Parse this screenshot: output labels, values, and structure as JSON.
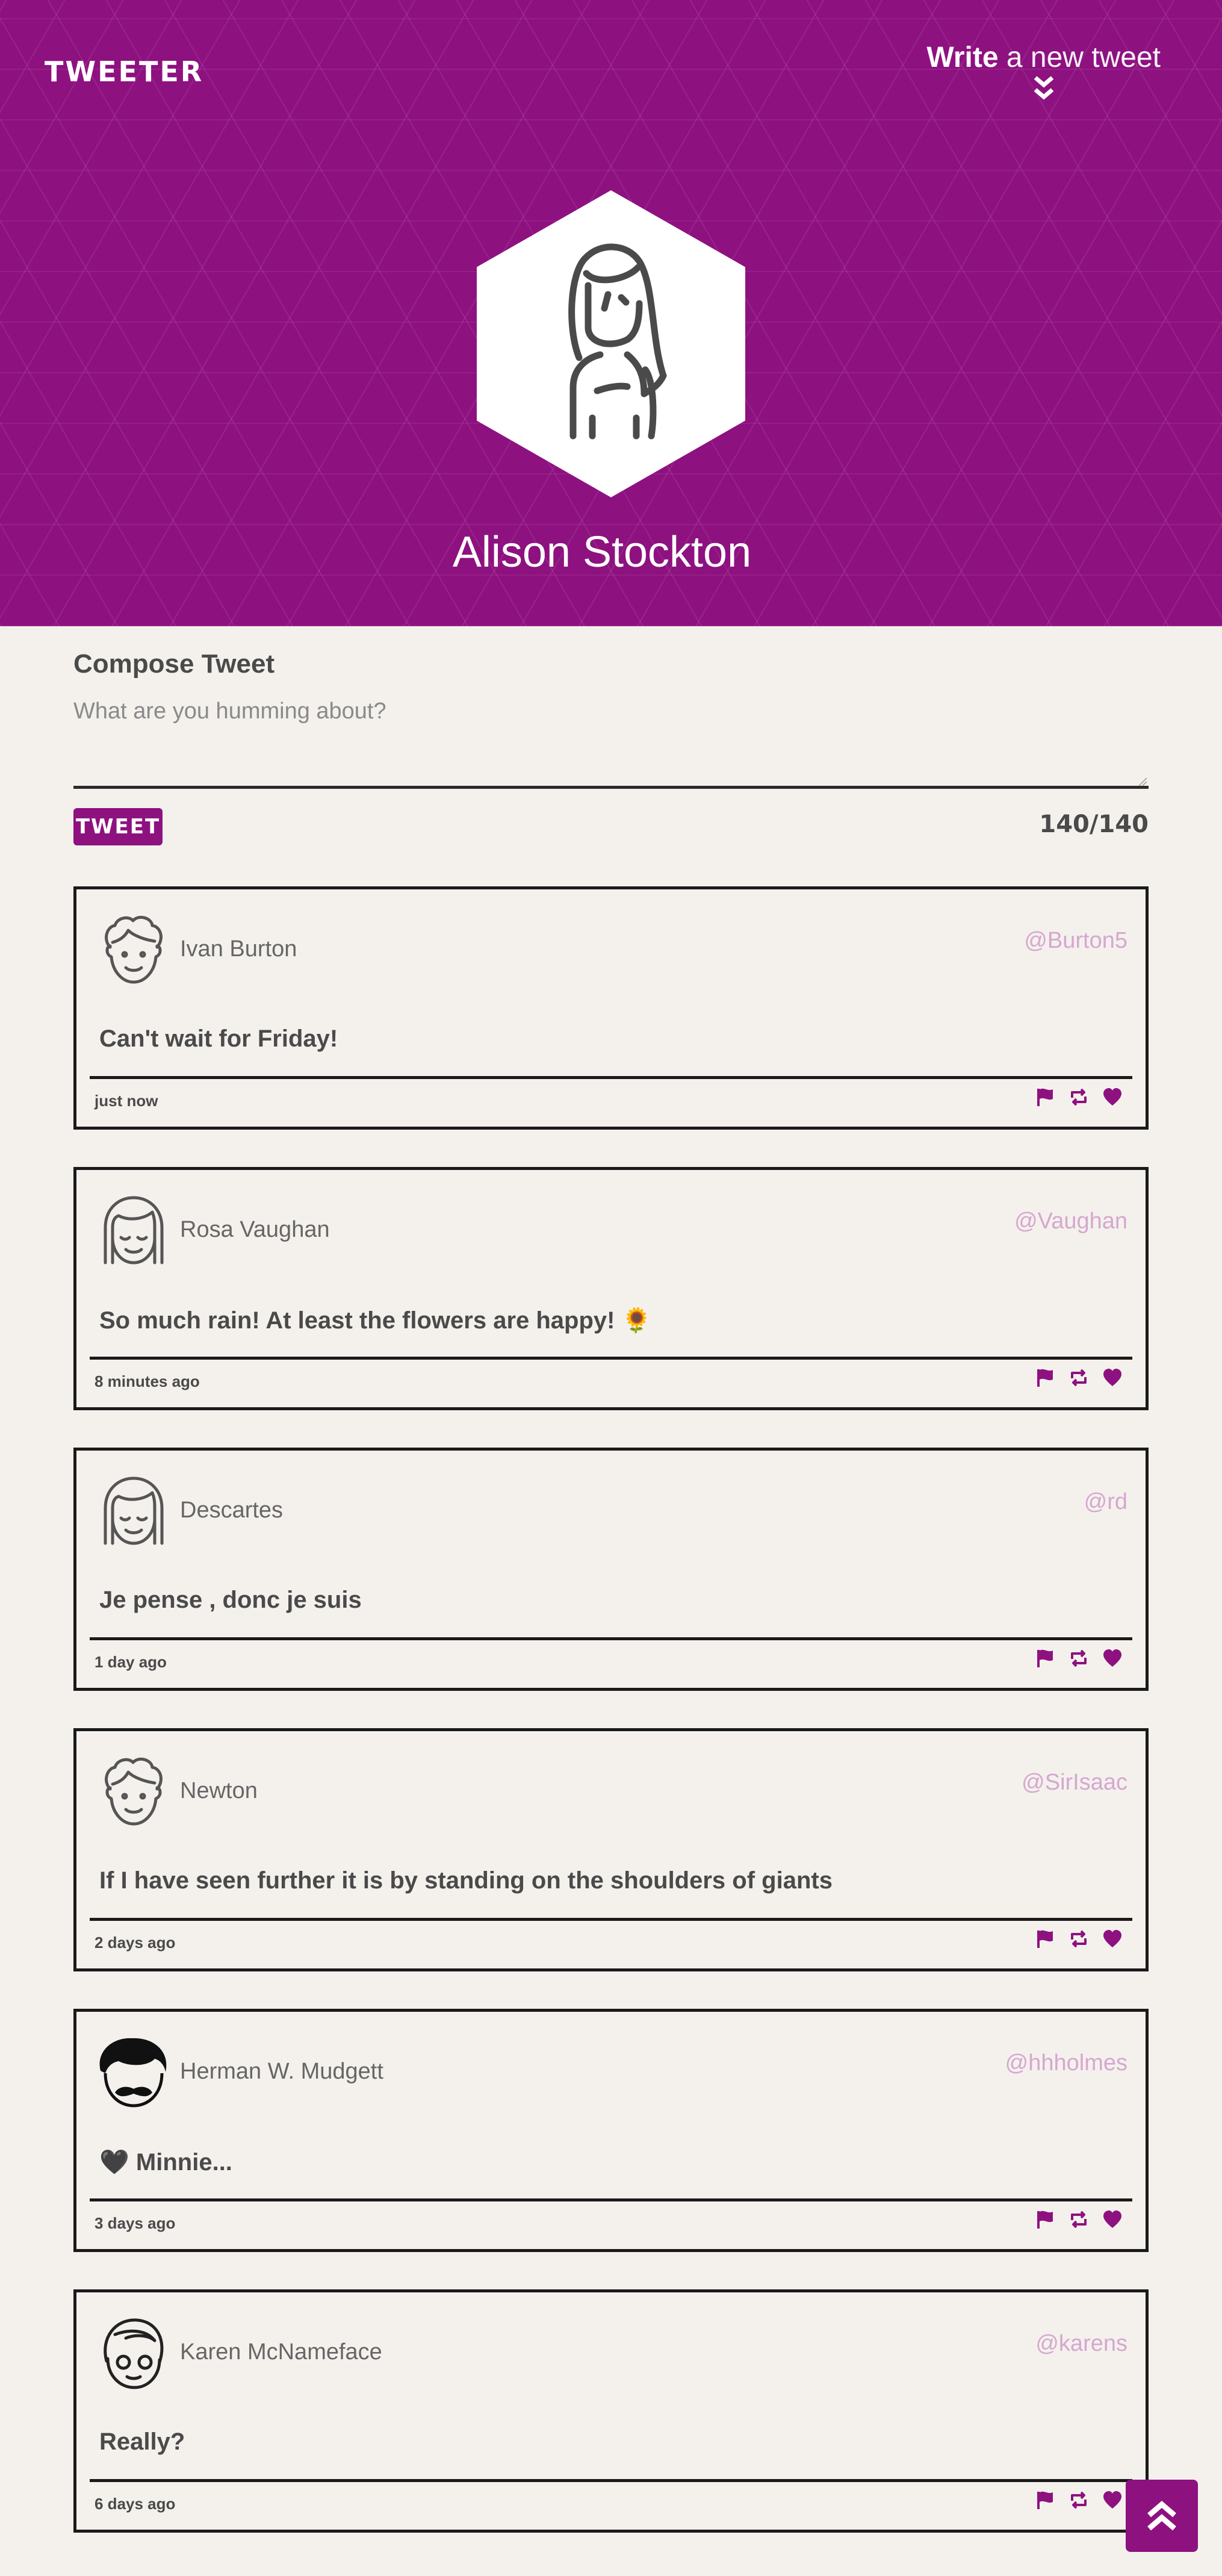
{
  "header": {
    "logo": "TWEETER",
    "write_bold": "Write",
    "write_rest": " a new tweet",
    "profile_name": "Alison Stockton"
  },
  "compose": {
    "title": "Compose Tweet",
    "placeholder": "What are you humming about?",
    "button_label": "TWEET",
    "counter": "140/140"
  },
  "colors": {
    "brand": "#8e1180",
    "handle": "#d6a7cf",
    "background": "#f4f1ed"
  },
  "tweets": [
    {
      "name": "Ivan Burton",
      "handle": "@Burton5",
      "content": "Can't wait for Friday!",
      "time": "just now",
      "avatar": "curly-hair-man-avatar"
    },
    {
      "name": "Rosa Vaughan",
      "handle": "@Vaughan",
      "content": "So much rain! At least the flowers are happy! 🌻",
      "time": "8 minutes ago",
      "avatar": "bob-hair-woman-avatar"
    },
    {
      "name": "Descartes",
      "handle": "@rd",
      "content": "Je pense , donc je suis",
      "time": "1 day ago",
      "avatar": "bob-hair-woman-avatar"
    },
    {
      "name": "Newton",
      "handle": "@SirIsaac",
      "content": "If I have seen further it is by standing on the shoulders of giants",
      "time": "2 days ago",
      "avatar": "curly-hair-man-avatar"
    },
    {
      "name": "Herman W. Mudgett",
      "handle": "@hhholmes",
      "content": "🖤 Minnie...",
      "time": "3 days ago",
      "avatar": "mustache-man-avatar"
    },
    {
      "name": "Karen McNameface",
      "handle": "@karens",
      "content": "Really?",
      "time": "6 days ago",
      "avatar": "face-mask-woman-avatar"
    }
  ]
}
